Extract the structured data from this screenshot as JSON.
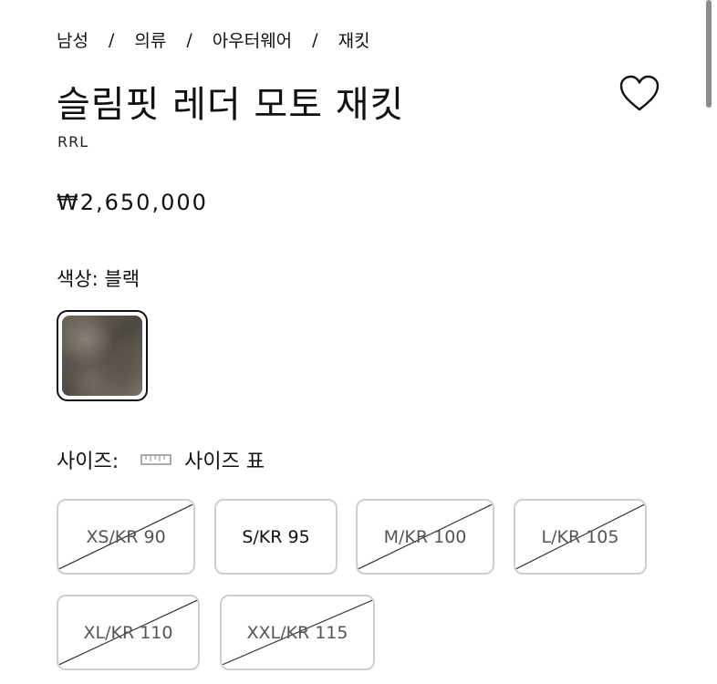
{
  "breadcrumb": [
    "남성",
    "의류",
    "아우터웨어",
    "재킷"
  ],
  "breadcrumb_separator": "/",
  "product": {
    "title": "슬림핏 레더 모토 재킷",
    "brand": "RRL",
    "price": "₩2,650,000"
  },
  "color": {
    "label": "색상:",
    "value": "블랙",
    "swatch_name": "블랙"
  },
  "size": {
    "label": "사이즈:",
    "chart_label": "사이즈 표",
    "options": [
      {
        "label": "XS/KR 90",
        "available": false
      },
      {
        "label": "S/KR 95",
        "available": true
      },
      {
        "label": "M/KR 100",
        "available": false
      },
      {
        "label": "L/KR 105",
        "available": false
      },
      {
        "label": "XL/KR 110",
        "available": false
      },
      {
        "label": "XXL/KR 115",
        "available": false
      }
    ]
  },
  "icons": {
    "wishlist": "heart-icon",
    "size_chart": "ruler-icon"
  }
}
